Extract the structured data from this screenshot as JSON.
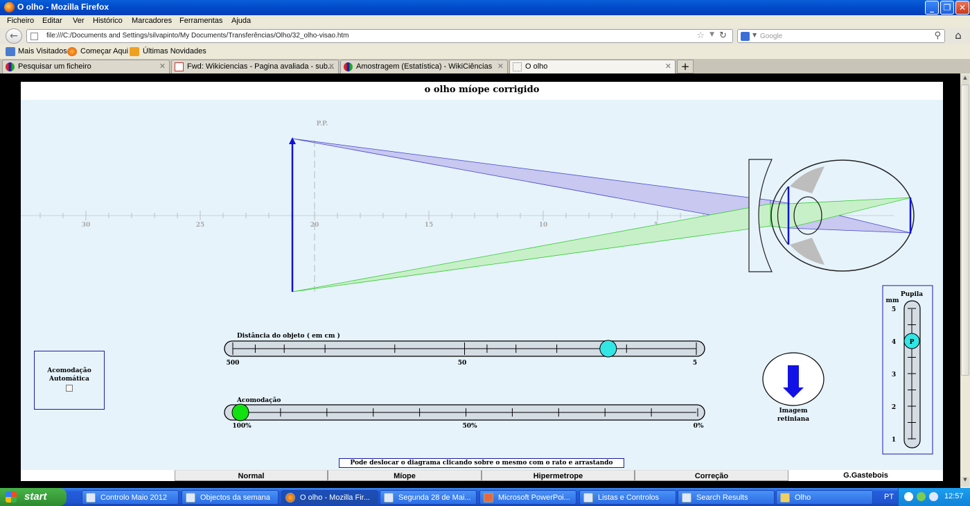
{
  "window": {
    "title": "O olho - Mozilla Firefox",
    "minimize": "_",
    "restore": "❐",
    "close": "✕"
  },
  "menu": [
    "Ficheiro",
    "Editar",
    "Ver",
    "Histórico",
    "Marcadores",
    "Ferramentas",
    "Ajuda"
  ],
  "nav": {
    "url": "file:///C:/Documents and Settings/silvapinto/My Documents/Transferências/Olho/32_olho-visao.htm",
    "search_placeholder": "Google"
  },
  "bookmarks": [
    "Mais Visitados",
    "Começar Aqui",
    "Últimas Novidades"
  ],
  "tabs": [
    {
      "label": "Pesquisar um ficheiro",
      "active": false
    },
    {
      "label": "Fwd: Wikiciencias - Pagina avaliada - sub...",
      "active": false
    },
    {
      "label": "Amostragem (Estatística) - WikiCiências",
      "active": false
    },
    {
      "label": "O olho",
      "active": true
    }
  ],
  "applet": {
    "title": "o olho míope corrigido",
    "pp_label": "P.P.",
    "axis_ticks": [
      "30",
      "25",
      "20",
      "15",
      "10",
      "5"
    ],
    "distance_slider": {
      "label": "Distância do objeto ( em cm )",
      "ticks": [
        "500",
        "50",
        "5"
      ],
      "value_cm": 12
    },
    "accommodation_slider": {
      "label": "Acomodação",
      "ticks": [
        "100%",
        "50%",
        "0%"
      ],
      "value_percent": 100
    },
    "auto_accommodation": {
      "label_line1": "Acomodação",
      "label_line2": "Automática",
      "checked": false
    },
    "retinal_image": {
      "line1": "Imagem",
      "line2": "retiniana"
    },
    "pupil": {
      "title": "Pupila",
      "unit": "mm",
      "scale": [
        "5",
        "4",
        "3",
        "2",
        "1"
      ],
      "handle_label": "P",
      "value_mm": 4
    },
    "info": "Pode deslocar o diagrama clicando sobre o mesmo com o rato e arrastando",
    "nav_buttons": [
      "Normal",
      "Míope",
      "Hipermetrope",
      "Correção"
    ],
    "author": "G.Gastebois",
    "colors": {
      "object": "#1212d6",
      "upper_beam": "#c8c8f0",
      "lower_beam": "#c8f0c8",
      "background": "#e6f3fb"
    }
  },
  "taskbar": {
    "start": "start",
    "items": [
      {
        "label": "Controlo Maio 2012",
        "active": false
      },
      {
        "label": "Objectos da semana",
        "active": false
      },
      {
        "label": "O olho - Mozilla Fir...",
        "active": true
      },
      {
        "label": "Segunda 28 de Mai...",
        "active": false
      },
      {
        "label": "Microsoft PowerPoi...",
        "active": false
      },
      {
        "label": "Listas e Controlos",
        "active": false
      },
      {
        "label": "Search Results",
        "active": false
      },
      {
        "label": "Olho",
        "active": false
      }
    ],
    "lang": "PT",
    "clock": "12:57"
  }
}
